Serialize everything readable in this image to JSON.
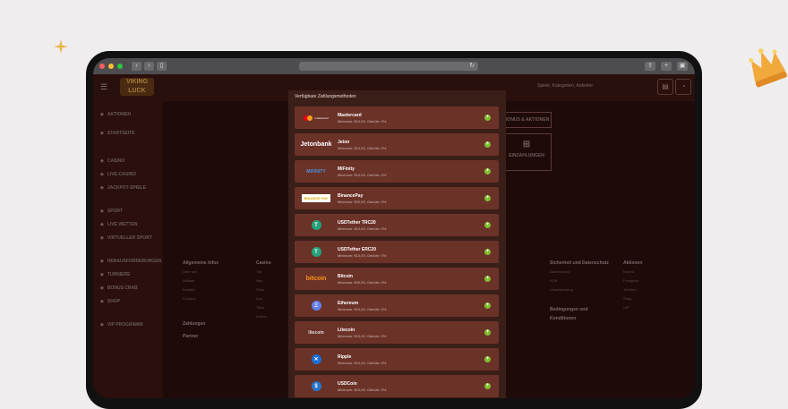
{
  "colors": {
    "background": "#efeded",
    "accent_green": "#7fbf2e",
    "card": "#6b3228",
    "modal": "#3a1e18",
    "brand_gold": "#a37b3e"
  },
  "browser": {
    "address_icon": "reload-icon"
  },
  "site": {
    "logo_text": "VIKING LUCK",
    "search_placeholder": "Spiele, Kategorien, Anbieter",
    "sidebar": [
      {
        "label": "AKTIONEN",
        "icon": "gift-icon"
      },
      {
        "label": "STARTSEITE",
        "icon": "home-icon"
      },
      {
        "label": "CASINO",
        "icon": "cards-icon"
      },
      {
        "label": "LIVE-CASINO",
        "icon": "live-icon"
      },
      {
        "label": "JACKPOT-SPIELE",
        "icon": "jackpot-icon"
      },
      {
        "label": "SPORT",
        "icon": "ball-icon"
      },
      {
        "label": "LIVE WETTEN",
        "icon": "tv-icon"
      },
      {
        "label": "VIRTUELLER SPORT",
        "icon": "virtual-icon"
      },
      {
        "label": "HERAUSFORDERUNGEN",
        "icon": "target-icon"
      },
      {
        "label": "TURNIERE",
        "icon": "trophy-icon"
      },
      {
        "label": "BONUS CRAB",
        "icon": "crab-icon"
      },
      {
        "label": "SHOP",
        "icon": "shop-icon"
      },
      {
        "label": "VIP PROGRAMM",
        "icon": "crown-icon"
      }
    ],
    "hero": {
      "promos_label": "BONUS & AKTIONEN",
      "deposits_label": "EINZAHLUNGEN"
    },
    "footer": {
      "col1_heading": "Allgemeine Infos",
      "col1_items": [
        "Über uns",
        "Affiliate",
        "Kontakt",
        "Cookies"
      ],
      "col1_heading2": "Zahlungen",
      "col1_heading3": "Partner",
      "col2_heading": "Casino",
      "col2_items": [
        "Top",
        "Neu",
        "Slots",
        "Live",
        "Tisch",
        "Karten"
      ],
      "col3_heading": "Sicherheit und Datenschutz",
      "col3_items": [
        "Datenschutz",
        "AGB",
        "Verantwortung"
      ],
      "col3_heading2": "Bedingungen und Konditionen",
      "col4_heading": "Aktionen",
      "col4_items": [
        "Bonus",
        "Freispiele",
        "Turniere",
        "Shop",
        "VIP"
      ]
    }
  },
  "modal": {
    "title": "Verfügbare Zahlungsmethoden",
    "methods": [
      {
        "name": "Mastercard",
        "limit": "Minimum: €10,00, Gebühr: 0%",
        "logo": "mastercard"
      },
      {
        "name": "Jeton",
        "limit": "Minimum: €10,00, Gebühr: 0%",
        "logo": "Jetonbank"
      },
      {
        "name": "MiFinity",
        "limit": "Minimum: €10,00, Gebühr: 0%",
        "logo": "MIFINITY"
      },
      {
        "name": "BinancePay",
        "limit": "Minimum: €20,00, Gebühr: 0%",
        "logo": "BINANCE PAY"
      },
      {
        "name": "USDTether TRC20",
        "limit": "Minimum: €10,00, Gebühr: 0%",
        "logo": "T"
      },
      {
        "name": "USDTether ERC20",
        "limit": "Minimum: €10,00, Gebühr: 0%",
        "logo": "T"
      },
      {
        "name": "Bitcoin",
        "limit": "Minimum: €30,00, Gebühr: 0%",
        "logo": "bitcoin"
      },
      {
        "name": "Ethereum",
        "limit": "Minimum: €10,00, Gebühr: 0%",
        "logo": "Ξ"
      },
      {
        "name": "Litecoin",
        "limit": "Minimum: €10,00, Gebühr: 0%",
        "logo": "litecoin"
      },
      {
        "name": "Ripple",
        "limit": "Minimum: €10,00, Gebühr: 0%",
        "logo": "✕"
      },
      {
        "name": "USDCoin",
        "limit": "Minimum: €10,00, Gebühr: 0%",
        "logo": "$"
      }
    ]
  }
}
